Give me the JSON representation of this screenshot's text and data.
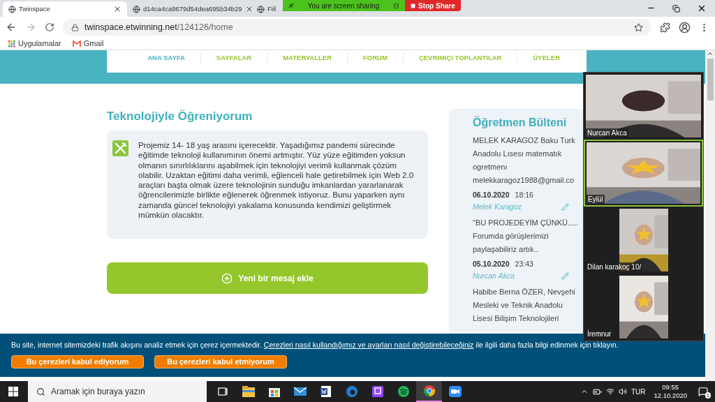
{
  "browser": {
    "tabs": [
      {
        "title": "Twinspace",
        "selected": true
      },
      {
        "title": "d14ca4ca9679d54dea695b34b29",
        "selected": false
      },
      {
        "title": "Fiil",
        "selected": false
      }
    ],
    "url_host": "twinspace.etwinning.net",
    "url_path": "/124126/home",
    "bookmarks": [
      "Uygulamalar",
      "Gmail"
    ]
  },
  "share_bar": {
    "status": "You are screen sharing",
    "stop": "Stop Share"
  },
  "nav": [
    {
      "label": "ANA SAYFA",
      "selected": true
    },
    {
      "label": "SAYFALAR",
      "selected": false
    },
    {
      "label": "MATERYALLER",
      "selected": false
    },
    {
      "label": "FORUM",
      "selected": false
    },
    {
      "label": "ÇEVRIMIÇI TOPLANTILAR",
      "selected": false
    },
    {
      "label": "ÜYELER",
      "selected": false
    }
  ],
  "project": {
    "title": "Teknolojiyle Öğreniyorum",
    "description": "Projemiz 14- 18 yaş arasını içerecektir. Yaşadığımız pandemi sürecinde eğitimde teknoloji kullanımının önemi artmıştır. Yüz yüze eğitimden yoksun olmanın sınırlılıklarını aşabilmek için teknolojiyi verimli kullanmak çözüm olabilir. Uzaktan eğitimi daha verimli, eğlenceli hale getirebilmek için Web 2.0 araçları başta olmak üzere teknolojinin sunduğu imkanlardan yararlanarak öğrencilerimizle birlikte eğlenerek öğrenmek istiyoruz. Bunu yaparken aynı zamanda güncel teknolojiyi yakalama konusunda kendimizi geliştirmek mümkün olacaktır.",
    "add_button": "Yeni bir mesaj ekle"
  },
  "bulletin": {
    "title": "Öğretmen Bülteni",
    "posts": [
      {
        "lines": [
          "MELEK KARAGOZ Baku Turk",
          "Anadolu Lısesı matematık",
          "ogretmenı",
          "melekkaragoz1988@gmail.co"
        ],
        "date": "06.10.2020",
        "time": "18:16",
        "author": "Melek Karagoz"
      },
      {
        "lines": [
          "\"BU PROJEDEYİM ÇÜNKÜ.....",
          "Forumda görüşlerimizi",
          "paylaşabiliriz artık.."
        ],
        "date": "05.10.2020",
        "time": "23:43",
        "author": "Nurcan Akca"
      },
      {
        "lines": [
          "Habibe Berna ÖZER, Nevşehi",
          "Mesleki ve Teknik Anadolu",
          "Lisesi Bilişim Teknolojileri"
        ]
      }
    ]
  },
  "video": [
    {
      "name": "Nurcan Akca",
      "speaking": false,
      "kind": "wide"
    },
    {
      "name": "Eylül",
      "speaking": true,
      "kind": "wide"
    },
    {
      "name": "Dilan karakoç 10/",
      "speaking": false,
      "kind": "narrow"
    },
    {
      "name": "İremnur",
      "speaking": false,
      "kind": "narrow"
    }
  ],
  "cookie": {
    "text_before": "Bu site, internet sitemizdeki trafik akışını analiz etmek için çerez içermektedir.",
    "link": "Çerezleri nasıl kullandığımız ve ayarları nasıl değiştirebileceğiniz",
    "text_after": "ile ilgili daha fazla bilgi edinmek için tıklayın.",
    "buttons": [
      "Bu çerezleri kabul ediyorum",
      "Bu çerezleri kabul etmiyorum"
    ]
  },
  "taskbar": {
    "search_placeholder": "Aramak için buraya yazın",
    "apps": [
      {
        "kind": "taskview",
        "selected": false
      },
      {
        "kind": "explorer",
        "selected": false
      },
      {
        "kind": "store",
        "selected": false
      },
      {
        "kind": "mail",
        "selected": false
      },
      {
        "kind": "word",
        "selected": false
      },
      {
        "kind": "edge",
        "selected": false
      },
      {
        "kind": "twitch",
        "selected": false
      },
      {
        "kind": "spotify",
        "selected": false
      },
      {
        "kind": "chrome",
        "selected": true
      },
      {
        "kind": "zoom",
        "selected": false
      }
    ],
    "language": "TUR",
    "time": "09:55",
    "date": "12.10.2020",
    "notifications": "1"
  }
}
